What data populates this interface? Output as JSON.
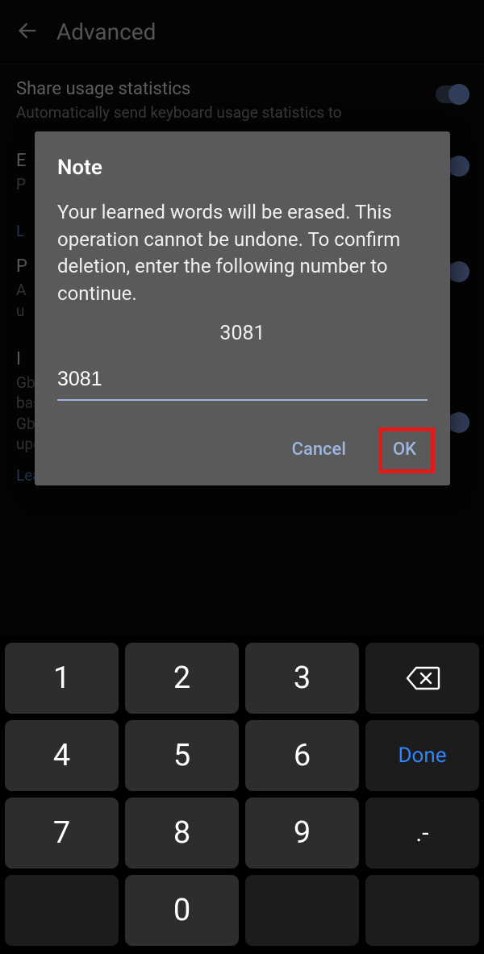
{
  "header": {
    "title": "Advanced"
  },
  "settings": {
    "share": {
      "title": "Share usage statistics",
      "sub": "Automatically send keyboard usage statistics to"
    },
    "row2_title_first": "E",
    "row2_sub_first": "P",
    "subheader_first": "L",
    "personalization": {
      "title_first": "P",
      "sub_first": "A",
      "sub2_first": "u"
    },
    "improve": {
      "title_first": "I",
      "sub": "Gboard will use these improvements on your device based on your usage patterns. With your permission, Gboard will use these improvements, in the aggregate, to update Google's voice and typing services."
    },
    "learn_more": "Learn more"
  },
  "dialog": {
    "title": "Note",
    "body": "Your learned words will be erased. This operation cannot be undone. To confirm deletion, enter the following number to continue.",
    "number": "3081",
    "input_value": "3081",
    "cancel": "Cancel",
    "ok": "OK"
  },
  "keyboard": {
    "k1": "1",
    "k2": "2",
    "k3": "3",
    "k4": "4",
    "k5": "5",
    "k6": "6",
    "k7": "7",
    "k8": "8",
    "k9": "9",
    "k0": "0",
    "done": "Done",
    "punct": ".-"
  }
}
